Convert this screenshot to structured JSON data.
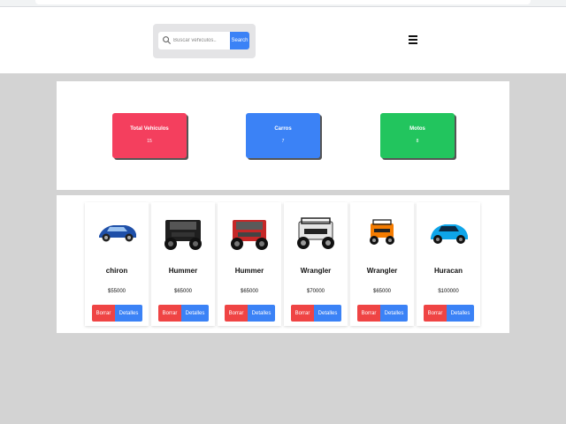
{
  "search": {
    "placeholder": "Buscar vehiculos..",
    "button_label": "Search"
  },
  "menu": {
    "icon": "hamburger-menu-icon"
  },
  "stats": [
    {
      "label": "Total Vehículos",
      "count": "15",
      "color": "#f43f5e"
    },
    {
      "label": "Carros",
      "count": "7",
      "color": "#3b82f6"
    },
    {
      "label": "Motos",
      "count": "8",
      "color": "#22c55e"
    }
  ],
  "products": [
    {
      "name": "chiron",
      "price": "$55000",
      "image": "sports-car-blue",
      "color": "#1e4fa8"
    },
    {
      "name": "Hummer",
      "price": "$65000",
      "image": "hummer-black",
      "color": "#1f1f1f"
    },
    {
      "name": "Hummer",
      "price": "$65000",
      "image": "hummer-red",
      "color": "#c62828"
    },
    {
      "name": "Wrangler",
      "price": "$70000",
      "image": "wrangler-white",
      "color": "#e5e5e5"
    },
    {
      "name": "Wrangler",
      "price": "$65000",
      "image": "wrangler-orange",
      "color": "#f57c00"
    },
    {
      "name": "Huracan",
      "price": "$100000",
      "image": "sports-car-cyan",
      "color": "#0ea5e9"
    }
  ],
  "actions": {
    "delete_label": "Borrar",
    "details_label": "Detalles"
  }
}
